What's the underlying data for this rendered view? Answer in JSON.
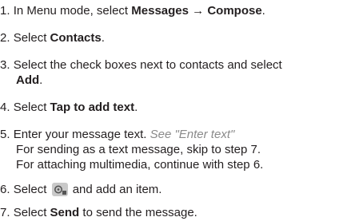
{
  "steps": [
    {
      "num": "1.",
      "t1": "In Menu mode, select ",
      "b1": "Messages",
      "arrow": " → ",
      "b2": "Compose",
      "end": "."
    },
    {
      "num": "2.",
      "t1": "Select ",
      "b1": "Contacts",
      "end": "."
    },
    {
      "num": "3.",
      "t1": "Select the check boxes next to contacts and select",
      "b1": "Add",
      "end": "."
    },
    {
      "num": "4.",
      "t1": "Select ",
      "b1": "Tap to add text",
      "end": "."
    },
    {
      "num": "5.",
      "t1": "Enter your message text. ",
      "ref": "See \"Enter text\"",
      "line2": "For sending as a text message, skip to step 7.",
      "line3": "For attaching multimedia, continue with step 6."
    },
    {
      "num": "6.",
      "t1": "Select ",
      "t2": " and add an item.",
      "icon": "attach-multimedia-icon"
    },
    {
      "num": "7.",
      "t1": "Select ",
      "b1": "Send",
      "t2": " to send the message."
    }
  ]
}
